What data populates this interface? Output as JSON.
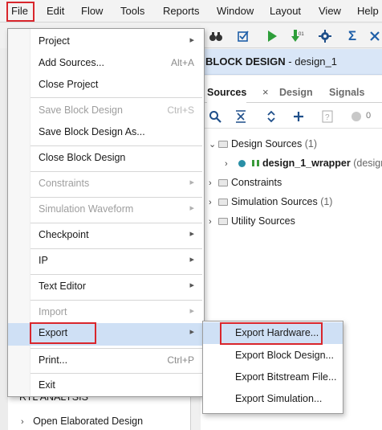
{
  "menubar": {
    "items": [
      "File",
      "Edit",
      "Flow",
      "Tools",
      "Reports",
      "Window",
      "Layout",
      "View",
      "Help"
    ]
  },
  "header": {
    "title_bold": "BLOCK DESIGN",
    "title_rest": " - design_1"
  },
  "sources": {
    "tabs": [
      "Sources",
      "Design",
      "Signals"
    ],
    "count_badge": "0",
    "tree": [
      {
        "label": "Design Sources",
        "count": "(1)"
      },
      {
        "label": "design_1_wrapper",
        "suffix": "(desigr"
      },
      {
        "label": "Constraints",
        "count": ""
      },
      {
        "label": "Simulation Sources",
        "count": "(1)"
      },
      {
        "label": "Utility Sources",
        "count": ""
      }
    ]
  },
  "left_pane": {
    "section": "RTL ANALYSIS",
    "item": "Open Elaborated Design"
  },
  "file_menu": {
    "items": [
      {
        "label": "Project",
        "shortcut": "",
        "submenu": true,
        "disabled": false
      },
      {
        "label": "Add Sources...",
        "shortcut": "Alt+A",
        "submenu": false,
        "disabled": false
      },
      {
        "label": "Close Project",
        "shortcut": "",
        "submenu": false,
        "disabled": false
      },
      {
        "label": "Save Block Design",
        "shortcut": "Ctrl+S",
        "submenu": false,
        "disabled": true
      },
      {
        "label": "Save Block Design As...",
        "shortcut": "",
        "submenu": false,
        "disabled": false
      },
      {
        "label": "Close Block Design",
        "shortcut": "",
        "submenu": false,
        "disabled": false
      },
      {
        "label": "Constraints",
        "shortcut": "",
        "submenu": true,
        "disabled": true
      },
      {
        "label": "Simulation Waveform",
        "shortcut": "",
        "submenu": true,
        "disabled": true
      },
      {
        "label": "Checkpoint",
        "shortcut": "",
        "submenu": true,
        "disabled": false
      },
      {
        "label": "IP",
        "shortcut": "",
        "submenu": true,
        "disabled": false
      },
      {
        "label": "Text Editor",
        "shortcut": "",
        "submenu": true,
        "disabled": false
      },
      {
        "label": "Import",
        "shortcut": "",
        "submenu": true,
        "disabled": true
      },
      {
        "label": "Export",
        "shortcut": "",
        "submenu": true,
        "disabled": false
      },
      {
        "label": "Print...",
        "shortcut": "Ctrl+P",
        "submenu": false,
        "disabled": false
      },
      {
        "label": "Exit",
        "shortcut": "",
        "submenu": false,
        "disabled": false
      }
    ]
  },
  "export_submenu": {
    "items": [
      "Export Hardware...",
      "Export Block Design...",
      "Export Bitstream File...",
      "Export Simulation..."
    ]
  },
  "colors": {
    "highlight_box": "#d9262c",
    "hover": "#cfe0f5",
    "header_bg": "#d9e6f7",
    "run_green": "#2e9e3a",
    "sigma_blue": "#1f5fa8"
  }
}
